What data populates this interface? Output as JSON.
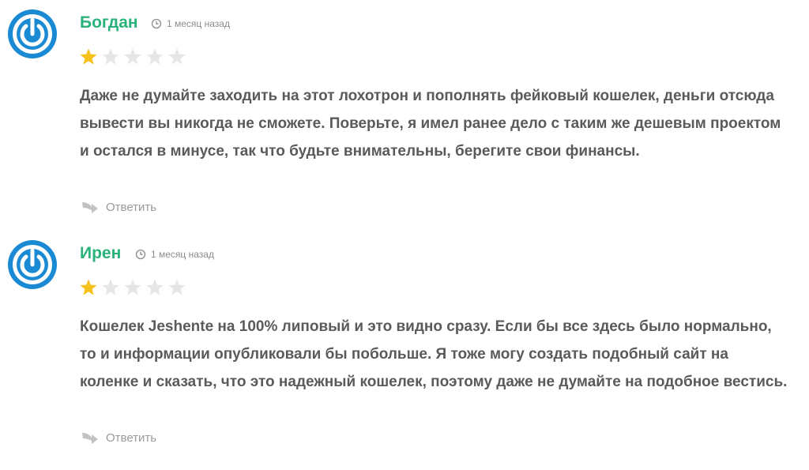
{
  "colors": {
    "author": "#2ab27b",
    "text": "#5a5a5a",
    "meta": "#8c8c8c",
    "star_filled": "#f5c21b",
    "star_empty": "#e6e6e6",
    "avatar_blue": "#1a8ad4"
  },
  "comments": [
    {
      "avatar_icon": "power-logo-icon",
      "author": "Богдан",
      "time_icon": "clock-icon",
      "time": "1 месяц назад",
      "rating": 1,
      "rating_max": 5,
      "text": "Даже не думайте заходить на этот лохотрон и пополнять фейковый кошелек, деньги отсюда вывести вы никогда не сможете. Поверьте, я имел ранее дело с таким же дешевым проектом и остался в минусе, так что будьте внимательны, берегите свои финансы.",
      "reply_icon": "reply-arrow-icon",
      "reply_label": "Ответить"
    },
    {
      "avatar_icon": "power-logo-icon",
      "author": "Ирен",
      "time_icon": "clock-icon",
      "time": "1 месяц назад",
      "rating": 1,
      "rating_max": 5,
      "text": "Кошелек Jeshente на 100% липовый и это видно сразу. Если бы все здесь было нормально, то и информации опубликовали бы побольше. Я тоже могу создать подобный сайт на коленке и сказать, что это надежный кошелек, поэтому даже не думайте на подобное вестись.",
      "reply_icon": "reply-arrow-icon",
      "reply_label": "Ответить"
    }
  ]
}
